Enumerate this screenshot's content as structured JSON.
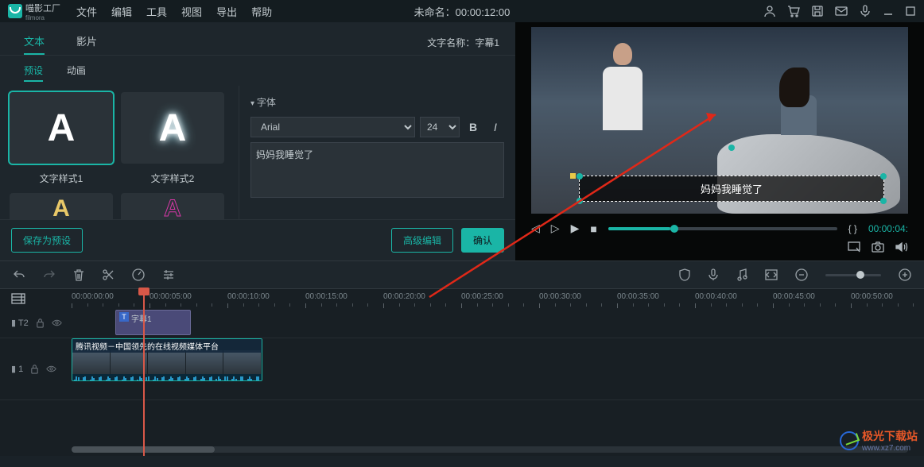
{
  "app": {
    "name": "喵影工厂",
    "sub": "filmora"
  },
  "menu": [
    "文件",
    "编辑",
    "工具",
    "视图",
    "导出",
    "帮助"
  ],
  "titleTime": "未命名：00:00:12:00",
  "tabs1": {
    "text": "文本",
    "clip": "影片"
  },
  "tabs2": {
    "preset": "预设",
    "anim": "动画"
  },
  "styles": {
    "s1": "文字样式1",
    "s2": "文字样式2"
  },
  "textNameLabel": "文字名称：",
  "textNameValue": "字幕1",
  "sectionFont": "字体",
  "fontFamily": "Arial",
  "fontSize": "24",
  "textContent": "妈妈我睡觉了",
  "subtitleOverlay": "妈妈我睡觉了",
  "btnSave": "保存为预设",
  "btnAdv": "高级编辑",
  "btnOk": "确认",
  "previewTime": "00:00:04:",
  "brackets": "{  }",
  "ruler": [
    "00:00:00:00",
    "00:00:05:00",
    "00:00:10:00",
    "00:00:15:00",
    "00:00:20:00",
    "00:00:25:00",
    "00:00:30:00",
    "00:00:35:00",
    "00:00:40:00",
    "00:00:45:00",
    "00:00:50:00"
  ],
  "trackT": "T2",
  "trackV": "1",
  "clipTitleLabel": "字幕1",
  "clipVideoLabel": "腾讯视频－中国领先的在线视频媒体平台",
  "watermark": {
    "t1": "极光下载站",
    "t2": "www.xz7.com"
  }
}
